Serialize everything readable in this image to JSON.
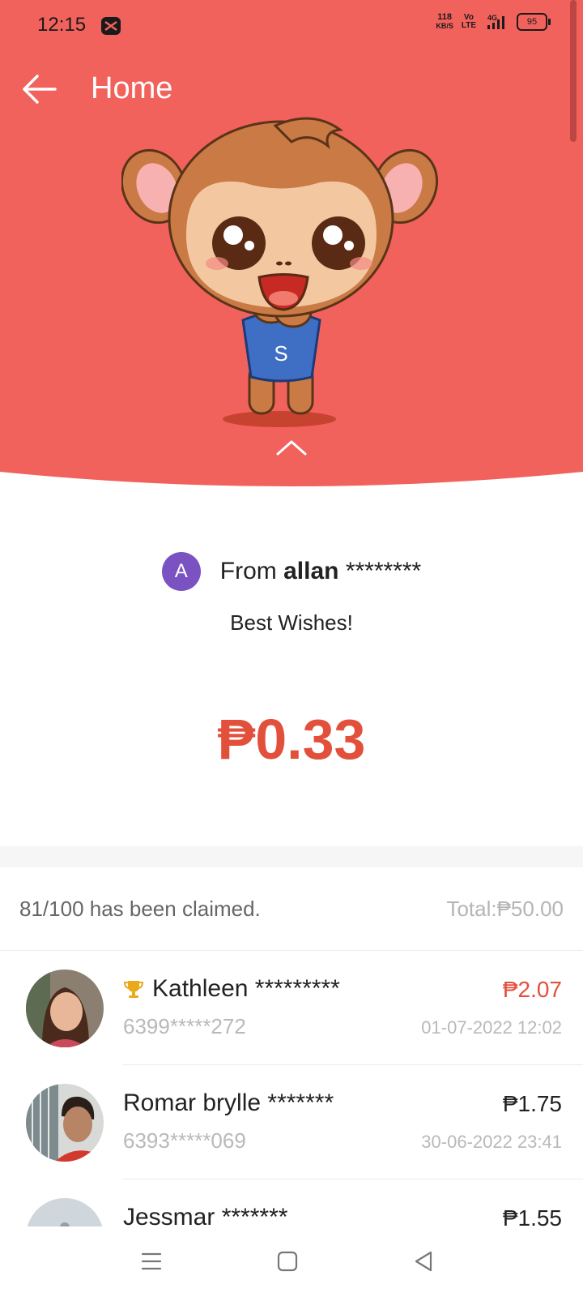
{
  "status_bar": {
    "time": "12:15",
    "net_speed_value": "118",
    "net_speed_unit": "KB/S",
    "volte_top": "Vo",
    "volte_bottom": "LTE",
    "network": "4G",
    "battery": "95"
  },
  "app_bar": {
    "title": "Home",
    "back_icon": "arrow-left-icon"
  },
  "envelope": {
    "sender_initial": "A",
    "from_label": "From",
    "sender_name": "allan",
    "sender_mask": "********",
    "message": "Best Wishes!",
    "amount": "₱0.33"
  },
  "summary": {
    "claimed_text": "81/100 has been claimed.",
    "total_text": "Total:₱50.00"
  },
  "claimants": [
    {
      "name": "Kathleen",
      "mask": "*********",
      "phone": "6399*****272",
      "amount": "₱2.07",
      "datetime": "01-07-2022 12:02",
      "top": true
    },
    {
      "name": "Romar brylle",
      "mask": "*******",
      "phone": "6393*****069",
      "amount": "₱1.75",
      "datetime": "30-06-2022 23:41",
      "top": false
    },
    {
      "name": "Jessmar",
      "mask": "*******",
      "phone": "",
      "amount": "₱1.55",
      "datetime": "",
      "top": false
    }
  ],
  "colors": {
    "hero_red": "#f2625d",
    "accent_red": "#e2503c",
    "avatar_purple": "#7a52c2",
    "trophy_gold": "#e9a91b"
  },
  "nav_bar": {
    "icons": [
      "menu-icon",
      "home-square-icon",
      "back-triangle-icon"
    ]
  }
}
